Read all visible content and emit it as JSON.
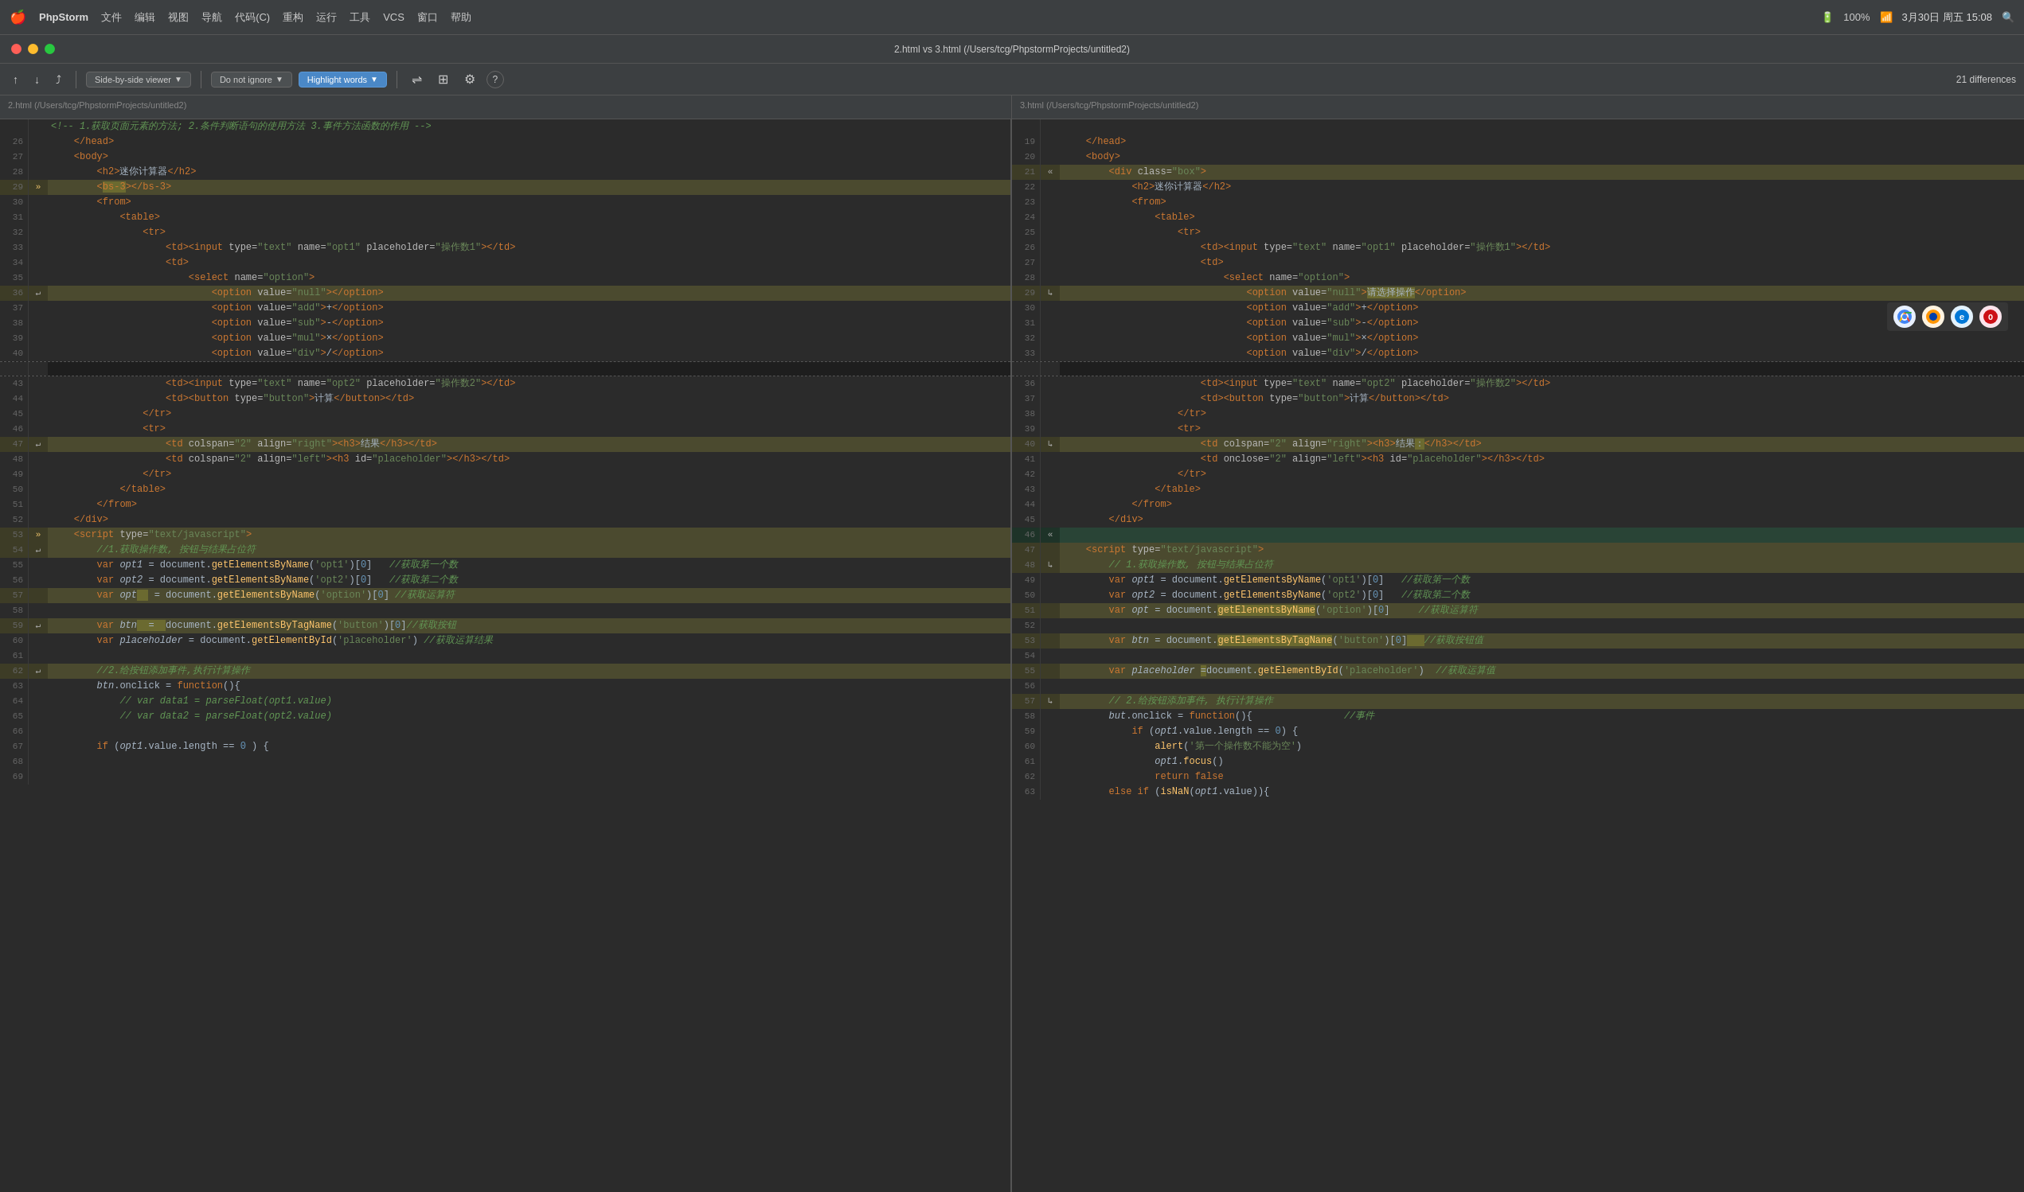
{
  "menubar": {
    "logo": "🍎",
    "app_name": "PhpStorm",
    "items": [
      "文件",
      "编辑",
      "视图",
      "导航",
      "代码(C)",
      "重构",
      "运行",
      "工具",
      "VCS",
      "窗口",
      "帮助"
    ],
    "battery": "100%",
    "date_time": "3月30日 周五 15:08",
    "search_icon": "🔍",
    "wifi": "📶"
  },
  "titlebar": {
    "text": "2.html vs 3.html (/Users/tcg/PhpstormProjects/untitled2)"
  },
  "toolbar": {
    "nav_prev": "↑",
    "nav_next": "↓",
    "jump_btn": "⤴",
    "viewer_label": "Side-by-side viewer",
    "ignore_label": "Do not ignore",
    "highlight_label": "Highlight words",
    "settings_icon": "⚙",
    "grid_icon": "⊞",
    "gear_icon": "⚙",
    "help_icon": "?",
    "diff_count": "21 differences"
  },
  "file_headers": {
    "left": "2.html (/Users/tcg/PhpstormProjects/untitled2)",
    "right": "3.html (/Users/tcg/PhpstormProjects/untitled2)"
  },
  "left_lines": [
    {
      "num": "26",
      "type": "normal",
      "content": "    </head>"
    },
    {
      "num": "27",
      "type": "normal",
      "content": "    <body>"
    },
    {
      "num": "28",
      "type": "normal",
      "content": "        <h2>迷你计算器</h2>"
    },
    {
      "num": "29",
      "type": "changed",
      "marker": "»",
      "content": "        <bs-3></bs-3>"
    },
    {
      "num": "30",
      "type": "normal",
      "content": "        <from>"
    },
    {
      "num": "31",
      "type": "normal",
      "content": "            <table>"
    },
    {
      "num": "32",
      "type": "normal",
      "content": "                <tr>"
    },
    {
      "num": "33",
      "type": "normal",
      "content": "                    <td><input type=\"text\" name=\"opt1\" placeholder=\"操作数1\"></td>"
    },
    {
      "num": "34",
      "type": "normal",
      "content": "                    <td>"
    },
    {
      "num": "35",
      "type": "normal",
      "content": "                        <select name=\"option\">"
    },
    {
      "num": "36",
      "type": "changed",
      "marker": "↵",
      "content": "                            <option value=\"null\"></option>"
    },
    {
      "num": "37",
      "type": "normal",
      "content": "                            <option value=\"add\">+</option>"
    },
    {
      "num": "38",
      "type": "normal",
      "content": "                            <option value=\"sub\">-</option>"
    },
    {
      "num": "39",
      "type": "normal",
      "content": "                            <option value=\"mul\">×</option>"
    },
    {
      "num": "40",
      "type": "normal",
      "content": "                            <option value=\"div\">/</option>"
    },
    {
      "num": "43",
      "type": "normal",
      "content": "                    <td><input type=\"text\" name=\"opt2\" placeholder=\"操作数2\"></td>"
    },
    {
      "num": "44",
      "type": "normal",
      "content": "                    <td><button type=\"button\">计算</button></td>"
    },
    {
      "num": "45",
      "type": "normal",
      "content": "                </tr>"
    },
    {
      "num": "46",
      "type": "normal",
      "content": "                <tr>"
    },
    {
      "num": "47",
      "type": "changed",
      "marker": "↵",
      "content": "                    <td colspan=\"2\" align=\"right\"><h3>结果</h3></td>"
    },
    {
      "num": "48",
      "type": "normal",
      "content": "                    <td colspan=\"2\" align=\"left\"><h3 id=\"placeholder\"></h3></td>"
    },
    {
      "num": "49",
      "type": "normal",
      "content": "                </tr>"
    },
    {
      "num": "50",
      "type": "normal",
      "content": "            </table>"
    },
    {
      "num": "51",
      "type": "normal",
      "content": "        </from>"
    },
    {
      "num": "52",
      "type": "normal",
      "content": "    </div>"
    },
    {
      "num": "53",
      "type": "changed",
      "marker": "»",
      "content": "    <script type=\"text/javascript\">"
    },
    {
      "num": "54",
      "type": "changed",
      "marker": "↵",
      "content": "        //1.获取操作数, 按钮与结果占位符"
    },
    {
      "num": "55",
      "type": "normal",
      "content": "        var opt1 = document.getElementsByName('opt1')[0]   //获取第一个数"
    },
    {
      "num": "56",
      "type": "normal",
      "content": "        var opt2 = document.getElementsByName('opt2')[0]   //获取第二个数"
    },
    {
      "num": "57",
      "type": "changed",
      "content": "        var opt  = document.getElementsByName('option')[0] //获取运算符"
    },
    {
      "num": "58",
      "type": "normal",
      "content": ""
    },
    {
      "num": "59",
      "type": "changed",
      "marker": "↵",
      "content": "        var btn  =  document.getElementsByTagName('button')[0]//获取按钮"
    },
    {
      "num": "60",
      "type": "normal",
      "content": "        var placeholder = document.getElementById('placeholder') //获取运算结果"
    },
    {
      "num": "61",
      "type": "normal",
      "content": ""
    },
    {
      "num": "62",
      "type": "changed",
      "marker": "↵",
      "content": "        //2.给按钮添加事件,执行计算操作"
    },
    {
      "num": "63",
      "type": "normal",
      "content": "        btn.onclick = function(){"
    },
    {
      "num": "64",
      "type": "normal",
      "content": "            // var data1 = parseFloat(opt1.value)"
    },
    {
      "num": "65",
      "type": "normal",
      "content": "            // var data2 = parseFloat(opt2.value)"
    },
    {
      "num": "66",
      "type": "normal",
      "content": ""
    },
    {
      "num": "67",
      "type": "normal",
      "content": "        if (opt1.value.length == 0 ) {"
    },
    {
      "num": "68",
      "type": "normal",
      "content": ""
    },
    {
      "num": "69",
      "type": "normal",
      "content": ""
    }
  ],
  "right_lines": [
    {
      "num": "19",
      "type": "normal",
      "content": "    </head>"
    },
    {
      "num": "20",
      "type": "normal",
      "content": "    <body>"
    },
    {
      "num": "21",
      "marker": "«",
      "type": "changed",
      "content": "        <div class=\"box\">"
    },
    {
      "num": "22",
      "type": "normal",
      "content": "            <h2>迷你计算器</h2>"
    },
    {
      "num": "23",
      "type": "normal",
      "content": "            <from>"
    },
    {
      "num": "24",
      "type": "normal",
      "content": "                <table>"
    },
    {
      "num": "25",
      "type": "normal",
      "content": "                    <tr>"
    },
    {
      "num": "26",
      "type": "normal",
      "content": "                        <td><input type=\"text\" name=\"opt1\" placeholder=\"操作数1\"></td>"
    },
    {
      "num": "27",
      "type": "normal",
      "content": "                        <td>"
    },
    {
      "num": "28",
      "type": "normal",
      "content": "                            <select name=\"option\">"
    },
    {
      "num": "29",
      "marker": "↳",
      "type": "changed",
      "content": "                                <option value=\"null\">请选择操作</option>"
    },
    {
      "num": "30",
      "type": "normal",
      "content": "                                <option value=\"add\">+</option>"
    },
    {
      "num": "31",
      "type": "normal",
      "content": "                                <option value=\"sub\">-</option>"
    },
    {
      "num": "32",
      "type": "normal",
      "content": "                                <option value=\"mul\">×</option>"
    },
    {
      "num": "33",
      "type": "normal",
      "content": "                                <option value=\"div\">/</option>"
    },
    {
      "num": "36",
      "type": "normal",
      "content": "                        <td><input type=\"text\" name=\"opt2\" placeholder=\"操作数2\"></td>"
    },
    {
      "num": "37",
      "type": "normal",
      "content": "                        <td><button type=\"button\">计算</button></td>"
    },
    {
      "num": "38",
      "type": "normal",
      "content": "                    </tr>"
    },
    {
      "num": "39",
      "type": "normal",
      "content": "                    <tr>"
    },
    {
      "num": "40",
      "marker": "↳",
      "type": "changed",
      "content": "                        <td colspan=\"2\" align=\"right\"><h3>结果：</h3></td>"
    },
    {
      "num": "41",
      "type": "normal",
      "content": "                        <td onclose=\"2\" align=\"left\"><h3 id=\"placeholder\"></h3></td>"
    },
    {
      "num": "42",
      "type": "normal",
      "content": "                    </tr>"
    },
    {
      "num": "43",
      "type": "normal",
      "content": "                </table>"
    },
    {
      "num": "44",
      "type": "normal",
      "content": "            </from>"
    },
    {
      "num": "45",
      "type": "normal",
      "content": "        </div>"
    },
    {
      "num": "46",
      "marker": "«",
      "type": "added",
      "content": ""
    },
    {
      "num": "47",
      "type": "changed",
      "content": "    <script type=\"text/javascript\">"
    },
    {
      "num": "48",
      "marker": "↳",
      "type": "changed",
      "content": "        // 1.获取操作数, 按钮与结果占位符"
    },
    {
      "num": "49",
      "type": "normal",
      "content": "        var opt1 = document.getElementsByName('opt1')[0]   //获取第一个数"
    },
    {
      "num": "50",
      "type": "normal",
      "content": "        var opt2 = document.getElementsByName('opt2')[0]   //获取第二个数"
    },
    {
      "num": "51",
      "type": "changed",
      "content": "        var opt = document.getElenentsByName('option')[0]   //获取运算符"
    },
    {
      "num": "52",
      "type": "normal",
      "content": ""
    },
    {
      "num": "53",
      "type": "changed",
      "content": "        var btn = document.getElementsByTagNane('button')[0]   //获取按钮值"
    },
    {
      "num": "54",
      "type": "normal",
      "content": ""
    },
    {
      "num": "55",
      "type": "changed",
      "content": "        var placeholder =document.getElementById('placeholder')  //获取运算值"
    },
    {
      "num": "56",
      "type": "normal",
      "content": ""
    },
    {
      "num": "57",
      "marker": "↳",
      "type": "changed",
      "content": "        // 2.给按钮添加事件, 执行计算操作"
    },
    {
      "num": "58",
      "type": "normal",
      "content": "        but.onclick = function(){                //事件"
    },
    {
      "num": "59",
      "type": "normal",
      "content": "            if (opt1.value.length == 0) {"
    },
    {
      "num": "60",
      "type": "normal",
      "content": "                alert('第一个操作数不能为空')"
    },
    {
      "num": "61",
      "type": "normal",
      "content": "                opt1.focus()"
    },
    {
      "num": "62",
      "type": "normal",
      "content": "                return false"
    },
    {
      "num": "63",
      "type": "normal",
      "content": "        else if (isNaN(opt1.value)){"
    }
  ],
  "colors": {
    "changed_bg": "#4b4a2f",
    "added_bg": "#294436",
    "removed_bg": "#3d2323",
    "normal_bg": "#2b2b2b",
    "accent": "#4a88c7"
  }
}
